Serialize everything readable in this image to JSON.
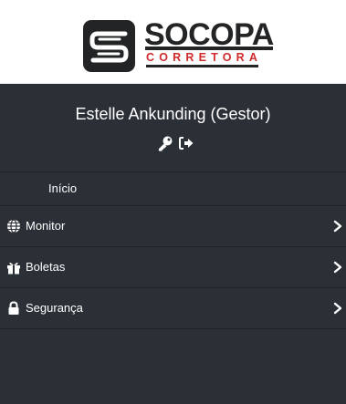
{
  "brand": {
    "name": "SOCOPA",
    "subtitle": "CORRETORA"
  },
  "user": {
    "display_name": "Estelle Ankunding (Gestor)"
  },
  "menu": {
    "items": [
      {
        "label": "Início"
      },
      {
        "label": "Monitor",
        "icon": "globe-icon"
      },
      {
        "label": "Boletas",
        "icon": "gift-icon"
      },
      {
        "label": "Segurança",
        "icon": "lock-icon"
      }
    ]
  },
  "colors": {
    "sidebar_bg": "#2b3036",
    "brand_red": "#cf2b2b",
    "brand_dark": "#232426"
  }
}
